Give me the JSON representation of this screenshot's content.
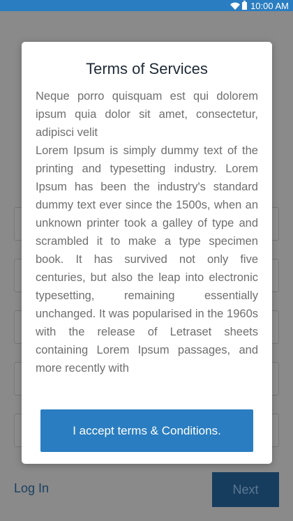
{
  "status_bar": {
    "time": "10:00 AM"
  },
  "modal": {
    "title": "Terms of Services",
    "paragraph_1": "Neque porro quisquam est qui dolorem ipsum quia dolor sit amet, consectetur, adipisci velit",
    "paragraph_2": "Lorem Ipsum is simply dummy text of the printing and typesetting industry. Lorem Ipsum has been the industry's standard dummy text ever since the 1500s, when an unknown printer took a galley of type and scrambled it to make a type specimen book. It has survived not only five centuries, but also the leap into electronic typesetting, remaining essentially unchanged. It was popularised in the 1960s with the release of Letraset sheets containing Lorem Ipsum passages, and more recently with",
    "accept_label": "I accept terms & Conditions."
  },
  "footer": {
    "login_label": "Log In",
    "next_label": "Next"
  },
  "colors": {
    "accent": "#2a7dc0",
    "overlay": "#8a8a8a",
    "next_button": "#173d5e"
  }
}
